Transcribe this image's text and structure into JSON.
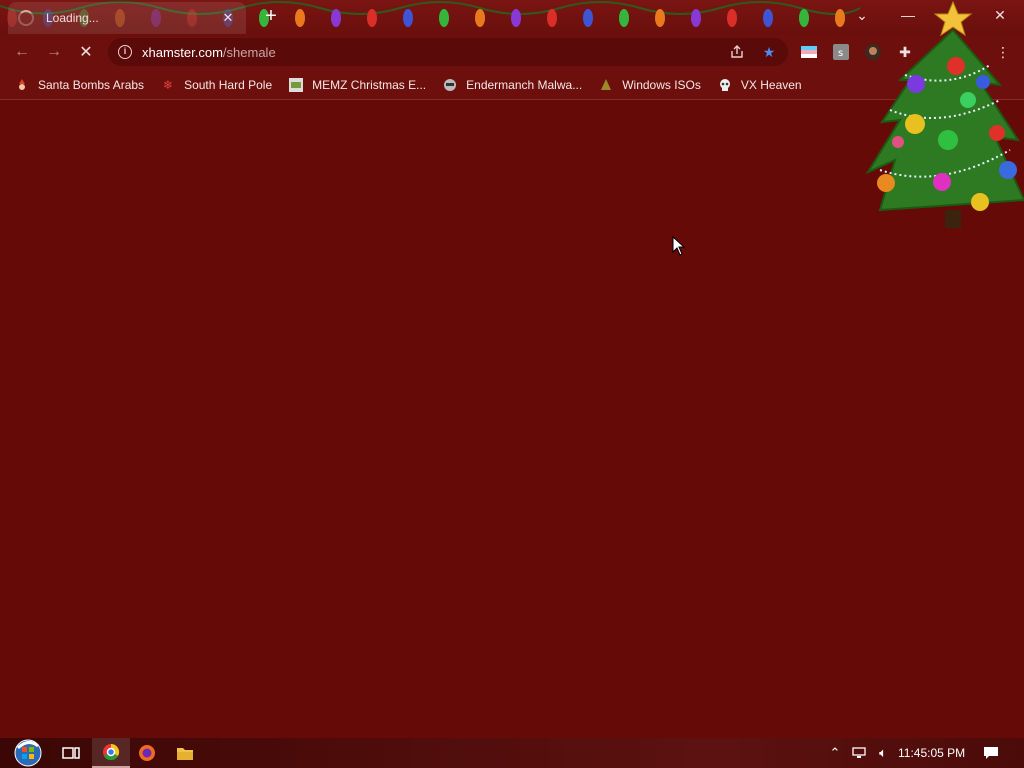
{
  "tab": {
    "title": "Loading..."
  },
  "address": {
    "host": "xhamster.com",
    "path": "/shemale"
  },
  "bookmarks": [
    {
      "label": "Santa Bombs Arabs",
      "icon": "santa-icon"
    },
    {
      "label": "South Hard Pole",
      "icon": "snowflake-icon"
    },
    {
      "label": "MEMZ Christmas E...",
      "icon": "page-icon"
    },
    {
      "label": "Endermanch Malwa...",
      "icon": "raccoon-icon"
    },
    {
      "label": "Windows ISOs",
      "icon": "tree-icon"
    },
    {
      "label": "VX Heaven",
      "icon": "skull-icon"
    }
  ],
  "taskbar": {
    "clock": "11:45:05 PM"
  },
  "colors": {
    "accent": "#660a08",
    "toolbar": "#6d0f0c"
  }
}
